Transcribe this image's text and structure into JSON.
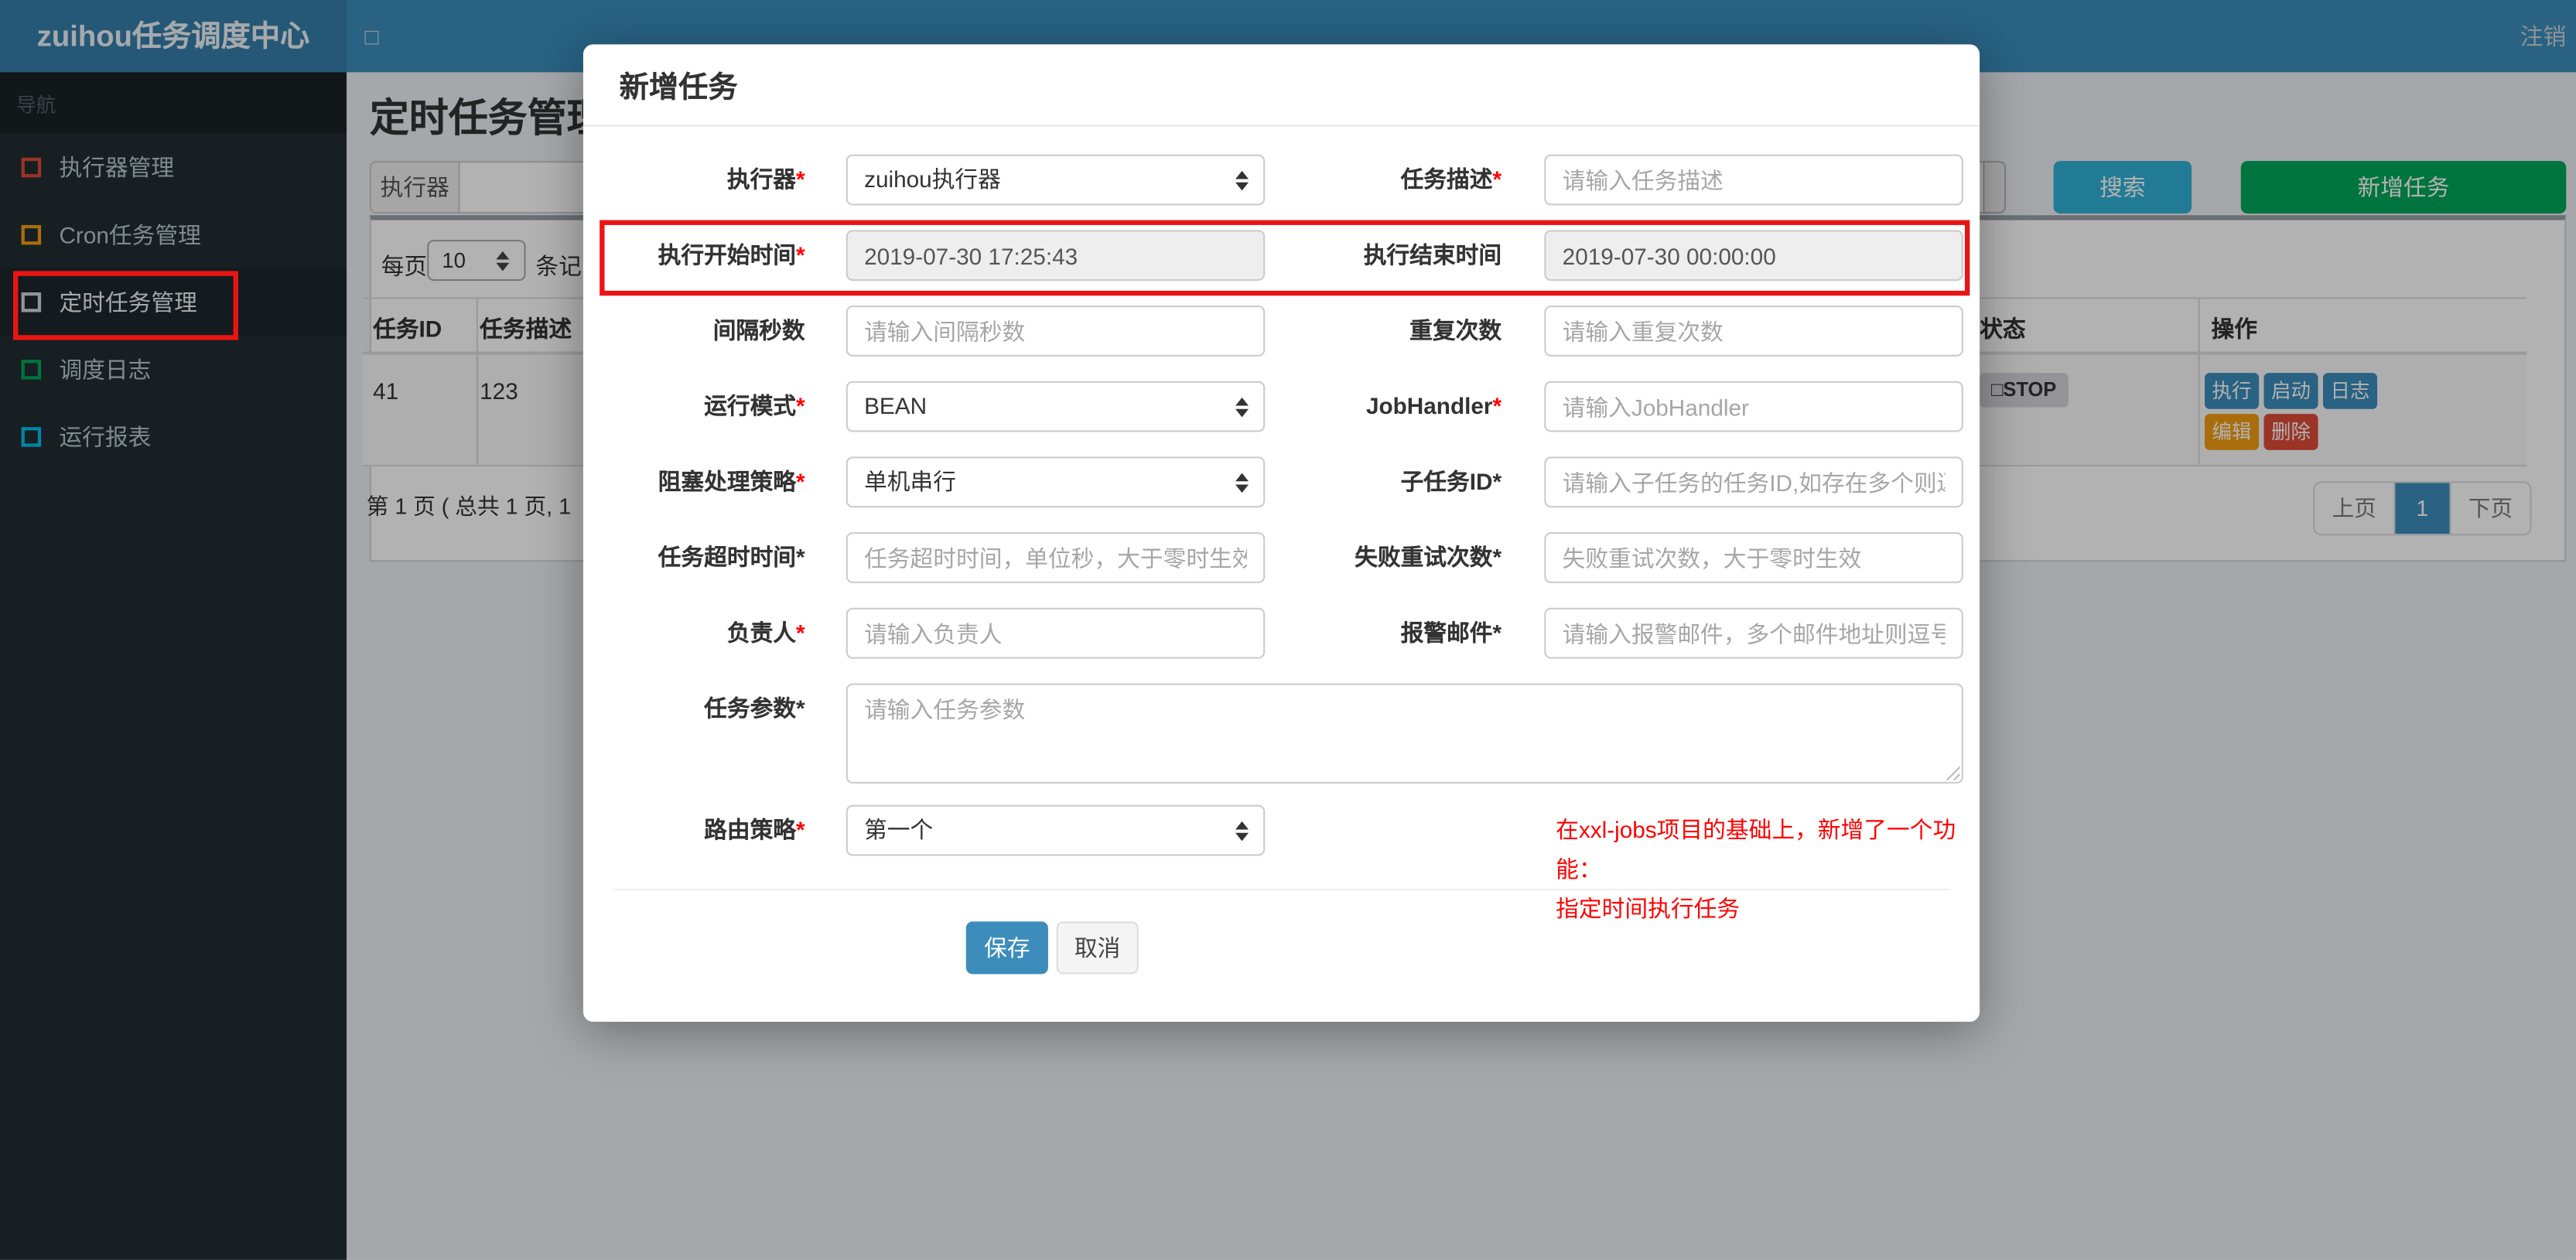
{
  "topbar": {
    "brand": "zuihou任务调度中心",
    "toggle_glyph": "□",
    "logout": "注销"
  },
  "sidebar": {
    "header": "导航",
    "items": [
      {
        "label": "执行器管理",
        "icon_color": "#dd4b39",
        "icon_style": "border-color:#dd4b39"
      },
      {
        "label": "Cron任务管理",
        "icon_color": "#f39c12",
        "icon_style": "border-color:#f39c12"
      },
      {
        "label": "定时任务管理",
        "icon_color": "#d2d6de",
        "icon_style": "border-color:#d2d6de"
      },
      {
        "label": "调度日志",
        "icon_color": "#00a65a",
        "icon_style": "border-color:#00a65a"
      },
      {
        "label": "运行报表",
        "icon_color": "#00c0ef",
        "icon_style": "border-color:#00c0ef"
      }
    ]
  },
  "page": {
    "title": "定时任务管理"
  },
  "filter": {
    "executor_label": "执行器",
    "search_button": "搜索",
    "add_button": "新增任务"
  },
  "list": {
    "per_page_prefix": "每页",
    "per_page_value": "10",
    "per_page_suffix": "条记",
    "headers": {
      "id": "任务ID",
      "desc": "任务描述",
      "status": "状态",
      "ops": "操作"
    },
    "row": {
      "id": "41",
      "desc": "123",
      "status_icon": "□",
      "status_text": "STOP",
      "ops": [
        "执行",
        "启动",
        "日志",
        "编辑",
        "删除"
      ]
    },
    "pagination": {
      "summary": "第 1 页 ( 总共 1 页, 1",
      "prev": "上页",
      "page": "1",
      "next": "下页"
    }
  },
  "modal": {
    "title": "新增任务",
    "rows": [
      {
        "l": {
          "label": "执行器",
          "star": "*",
          "value": "zuihou执行器"
        },
        "r": {
          "label": "任务描述",
          "star": "*",
          "placeholder": "请输入任务描述"
        }
      },
      {
        "l": {
          "label": "执行开始时间",
          "star": "*",
          "value": "2019-07-30 17:25:43"
        },
        "r": {
          "label": "执行结束时间",
          "star": "",
          "value": "2019-07-30 00:00:00"
        }
      },
      {
        "l": {
          "label": "间隔秒数",
          "star": "",
          "placeholder": "请输入间隔秒数"
        },
        "r": {
          "label": "重复次数",
          "star": "",
          "placeholder": "请输入重复次数"
        }
      },
      {
        "l": {
          "label": "运行模式",
          "star": "*",
          "value": "BEAN"
        },
        "r": {
          "label": "JobHandler",
          "star": "*",
          "placeholder": "请输入JobHandler"
        }
      },
      {
        "l": {
          "label": "阻塞处理策略",
          "star": "*",
          "value": "单机串行"
        },
        "r": {
          "label": "子任务ID",
          "star": "*",
          "placeholder": "请输入子任务的任务ID,如存在多个则逗号分隔"
        }
      },
      {
        "l": {
          "label": "任务超时时间",
          "star": "*",
          "placeholder": "任务超时时间，单位秒，大于零时生效"
        },
        "r": {
          "label": "失败重试次数",
          "star": "*",
          "placeholder": "失败重试次数，大于零时生效"
        }
      },
      {
        "l": {
          "label": "负责人",
          "star": "*",
          "placeholder": "请输入负责人"
        },
        "r": {
          "label": "报警邮件",
          "star": "*",
          "placeholder": "请输入报警邮件，多个邮件地址则逗号分隔"
        }
      }
    ],
    "param": {
      "label": "任务参数",
      "star": "*",
      "placeholder": "请输入任务参数"
    },
    "route": {
      "label": "路由策略",
      "star": "*",
      "value": "第一个"
    },
    "note_line1": "在xxl-jobs项目的基础上，新增了一个功能：",
    "note_line2": "指定时间执行任务",
    "save_button": "保存",
    "cancel_button": "取消"
  },
  "colors": {
    "topbar_bg": "#3c8dbc",
    "brand_bg": "#367fa9",
    "sidebar_bg": "#222d32",
    "content_bg": "#ecf0f5",
    "primary": "#3c8dbc",
    "info": "#31b0d5",
    "success": "#00a65a",
    "warning": "#f39c12",
    "danger": "#dd4b39",
    "status_badge_bg": "#d4d4da",
    "required_red": "#ff0000",
    "note_red": "#ff0000",
    "annotation_red": "#ea1414"
  }
}
